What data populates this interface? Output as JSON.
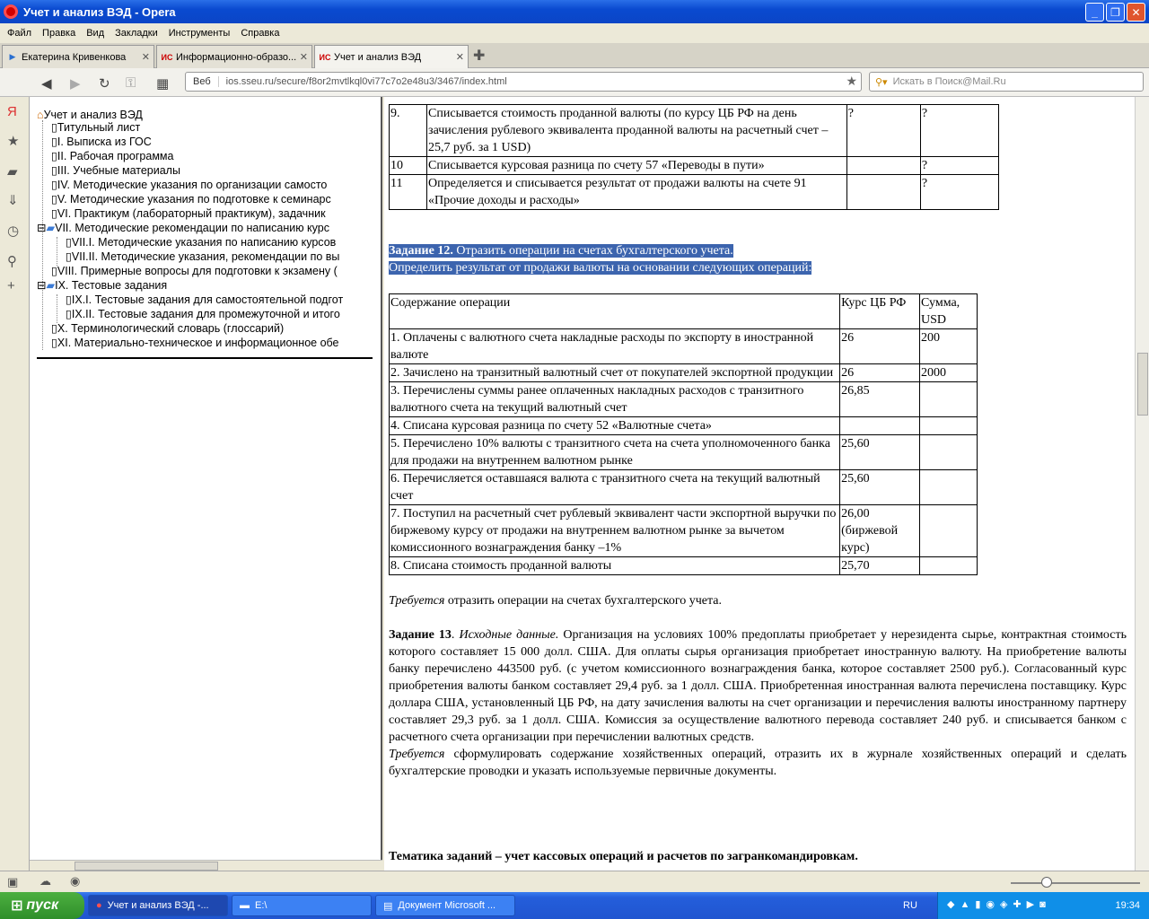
{
  "window": {
    "title": "Учет и анализ ВЭД - Opera"
  },
  "menu": [
    "Файл",
    "Правка",
    "Вид",
    "Закладки",
    "Инструменты",
    "Справка"
  ],
  "tabs": [
    {
      "label": "Екатерина Кривенкова"
    },
    {
      "label": "Информационно-образо..."
    },
    {
      "label": "Учет и анализ ВЭД"
    }
  ],
  "address": {
    "prefix": "Веб",
    "url": "ios.sseu.ru/secure/f8or2mvtlkql0vi77c7o2e48u3/3467/index.html"
  },
  "search": {
    "placeholder": "Искать в Поиск@Mail.Ru"
  },
  "tree": {
    "root": "Учет и анализ ВЭД",
    "items": [
      "Титульный лист",
      "I. Выписка из ГОС",
      "II. Рабочая программа",
      "III. Учебные материалы",
      "IV. Методические указания по организации самосто",
      "V. Методические указания по подготовке к семинарс",
      "VI. Практикум (лабораторный практикум), задачник",
      "VII. Методические рекомендации по написанию курс",
      "VII.I. Методические указания по написанию курсов",
      "VII.II. Методические указания, рекомендации по вы",
      "VIII. Примерные вопросы для подготовки к экзамену (",
      "IX. Тестовые задания",
      "IX.I. Тестовые задания для самостоятельной подгот",
      "IX.II. Тестовые задания для промежуточной и итого",
      "X. Терминологический словарь (глоссарий)",
      "XI. Материально-техническое и информационное обе"
    ]
  },
  "table1": {
    "rows": [
      {
        "num": "9.",
        "text": "Списывается стоимость проданной валюты (по курсу ЦБ РФ на день зачисления рублевого эквивалента проданной валюты на расчетный счет – 25,7 руб. за 1 USD)",
        "c1": "?",
        "c2": "?"
      },
      {
        "num": "10",
        "text": "Списывается курсовая разница по счету 57 «Переводы в пути»",
        "c1": "",
        "c2": "?"
      },
      {
        "num": "11",
        "text": "Определяется и списывается результат от продажи валюты на счете 91 «Прочие доходы и расходы»",
        "c1": "",
        "c2": "?"
      }
    ]
  },
  "task12": {
    "label": "Задание 12.",
    "line1": " Отразить операции на счетах бухгалтерского учета.",
    "line2": " Определить результат от продажи валюты на основании следующих операций:"
  },
  "table2": {
    "headers": [
      "Содержание операции",
      "Курс ЦБ РФ",
      "Сумма, USD"
    ],
    "rows": [
      {
        "text": "1. Оплачены с валютного счета накладные расходы по экспорту в иностранной валюте",
        "rate": "26",
        "sum": "200"
      },
      {
        "text": "2. Зачислено на транзитный валютный счет от покупателей экспортной продукции",
        "rate": "26",
        "sum": "2000"
      },
      {
        "text": "3. Перечислены суммы ранее оплаченных накладных расходов с транзитного валютного счета на текущий валютный счет",
        "rate": "26,85",
        "sum": ""
      },
      {
        "text": "4. Списана курсовая разница по счету 52 «Валютные счета»",
        "rate": "",
        "sum": ""
      },
      {
        "text": "5. Перечислено 10% валюты с транзитного счета на счета уполномоченного банка для продажи на внутреннем валютном рынке",
        "rate": "25,60",
        "sum": ""
      },
      {
        "text": "6. Перечисляется оставшаяся валюта с транзитного счета на текущий валютный счет",
        "rate": "25,60",
        "sum": ""
      },
      {
        "text": "7. Поступил на расчетный счет рублевый эквивалент части экспортной выручки по биржевому курсу от продажи на внутреннем валютном рынке за вычетом комиссионного вознаграждения банку –1%",
        "rate": "26,00 (биржевой курс)",
        "sum": ""
      },
      {
        "text": "8. Списана стоимость проданной валюты",
        "rate": "25,70",
        "sum": ""
      }
    ]
  },
  "required12": {
    "em": "Требуется",
    "text": " отразить операции на счетах бухгалтерского учета."
  },
  "task13": {
    "label": "Задание 13",
    "em": "Исходные данные.",
    "text": " Организация на условиях 100% предоплаты приобретает у нерезидента сырье, контрактная стоимость которого составляет 15 000 долл. США. Для оплаты сырья организация приобретает иностранную валюту. На приобретение валюты банку перечислено 443500 руб. (с учетом комиссионного вознаграждения банка, которое составляет 2500 руб.). Согласованный курс приобретения валюты банком составляет 29,4 руб. за 1 долл. США. Приобретенная иностранная валюта перечислена поставщику. Курс доллара США, установленный ЦБ РФ, на дату зачисления валюты на счет организации и перечисления валюты иностранному партнеру составляет 29,3 руб. за 1 долл. США. Комиссия за осуществление валютного перевода составляет 240 руб. и списывается банком с расчетного счета организации при перечислении валютных средств.",
    "req_em": "Требуется",
    "req_text": " сформулировать содержание хозяйственных операций, отразить их в журнале хозяйственных операций и сделать бухгалтерские проводки и указать используемые первичные документы."
  },
  "heading": "Тематика заданий – учет кассовых операций и расчетов по загранкомандировкам.",
  "taskbar": {
    "start": "пуск",
    "buttons": [
      "Учет и анализ ВЭД -...",
      "E:\\",
      "Документ Microsoft ..."
    ],
    "lang": "RU",
    "clock": "19:34"
  },
  "colors": {
    "selection": "#3c64ae",
    "titlebar": "#0a4ad0",
    "start": "#2f8f2a"
  }
}
